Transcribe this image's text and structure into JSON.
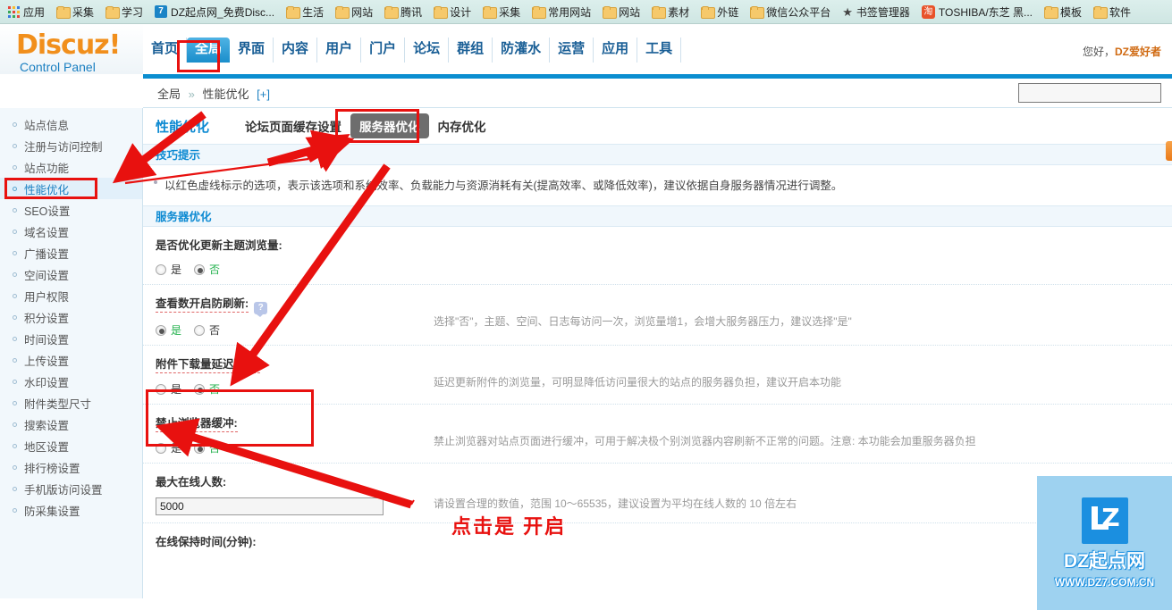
{
  "browser": {
    "bookmarks": [
      {
        "label": "应用",
        "icon": "apps-grid-icon"
      },
      {
        "label": "采集",
        "icon": "folder-icon"
      },
      {
        "label": "学习",
        "icon": "folder-icon"
      },
      {
        "label": "DZ起点网_免费Disc...",
        "icon": "dz-favicon-icon"
      },
      {
        "label": "生活",
        "icon": "folder-icon"
      },
      {
        "label": "网站",
        "icon": "folder-icon"
      },
      {
        "label": "腾讯",
        "icon": "folder-icon"
      },
      {
        "label": "设计",
        "icon": "folder-icon"
      },
      {
        "label": "采集",
        "icon": "folder-icon"
      },
      {
        "label": "常用网站",
        "icon": "folder-icon"
      },
      {
        "label": "网站",
        "icon": "folder-icon"
      },
      {
        "label": "素材",
        "icon": "folder-icon"
      },
      {
        "label": "外链",
        "icon": "folder-icon"
      },
      {
        "label": "微信公众平台",
        "icon": "folder-icon"
      },
      {
        "label": "书签管理器",
        "icon": "star-icon"
      },
      {
        "label": "TOSHIBA/东芝 黑...",
        "icon": "taobao-icon"
      },
      {
        "label": "模板",
        "icon": "folder-icon"
      },
      {
        "label": "软件",
        "icon": "folder-icon"
      }
    ]
  },
  "header": {
    "logo_main": "Discuz!",
    "logo_sub": "Control Panel",
    "greeting_prefix": "您好，",
    "greeting_user": "DZ爱好者",
    "nav": [
      {
        "label": "首页",
        "active": false
      },
      {
        "label": "全局",
        "active": true
      },
      {
        "label": "界面",
        "active": false
      },
      {
        "label": "内容",
        "active": false
      },
      {
        "label": "用户",
        "active": false
      },
      {
        "label": "门户",
        "active": false
      },
      {
        "label": "论坛",
        "active": false
      },
      {
        "label": "群组",
        "active": false
      },
      {
        "label": "防灌水",
        "active": false
      },
      {
        "label": "运营",
        "active": false
      },
      {
        "label": "应用",
        "active": false
      },
      {
        "label": "工具",
        "active": false
      }
    ]
  },
  "breadcrumb": {
    "root": "全局",
    "separator": "»",
    "current": "性能优化",
    "expand": "[+]"
  },
  "search": {
    "value": "",
    "placeholder": ""
  },
  "sidebar": {
    "items": [
      {
        "label": "站点信息",
        "active": false
      },
      {
        "label": "注册与访问控制",
        "active": false
      },
      {
        "label": "站点功能",
        "active": false
      },
      {
        "label": "性能优化",
        "active": true
      },
      {
        "label": "SEO设置",
        "active": false
      },
      {
        "label": "域名设置",
        "active": false
      },
      {
        "label": "广播设置",
        "active": false
      },
      {
        "label": "空间设置",
        "active": false
      },
      {
        "label": "用户权限",
        "active": false
      },
      {
        "label": "积分设置",
        "active": false
      },
      {
        "label": "时间设置",
        "active": false
      },
      {
        "label": "上传设置",
        "active": false
      },
      {
        "label": "水印设置",
        "active": false
      },
      {
        "label": "附件类型尺寸",
        "active": false
      },
      {
        "label": "搜索设置",
        "active": false
      },
      {
        "label": "地区设置",
        "active": false
      },
      {
        "label": "排行榜设置",
        "active": false
      },
      {
        "label": "手机版访问设置",
        "active": false
      },
      {
        "label": "防采集设置",
        "active": false
      }
    ]
  },
  "main": {
    "page_title": "性能优化",
    "tabs": [
      {
        "label": "论坛页面缓存设置",
        "active": false
      },
      {
        "label": "服务器优化",
        "active": true
      },
      {
        "label": "内存优化",
        "active": false
      }
    ],
    "tips_section_title": "技巧提示",
    "tips_text": "以红色虚线标示的选项，表示该选项和系统效率、负载能力与资源消耗有关(提高效率、或降低效率)，建议依据自身服务器情况进行调整。",
    "form_section_title": "服务器优化",
    "yes_label": "是",
    "no_label": "否",
    "rows": [
      {
        "label": "是否优化更新主题浏览量:",
        "selected": "否",
        "hint": "",
        "help_icon": false,
        "dashed": false
      },
      {
        "label": "查看数开启防刷新:",
        "selected": "是",
        "hint": "选择\"否\"，主题、空间、日志每访问一次，浏览量增1，会增大服务器压力，建议选择\"是\"",
        "help_icon": true,
        "dashed": true
      },
      {
        "label": "附件下载量延迟更新:",
        "selected": "否",
        "hint": "延迟更新附件的浏览量，可明显降低访问量很大的站点的服务器负担，建议开启本功能",
        "help_icon": false,
        "dashed": true
      },
      {
        "label": "禁止浏览器缓冲:",
        "selected": "否",
        "hint": "禁止浏览器对站点页面进行缓冲，可用于解决极个别浏览器内容刷新不正常的问题。注意: 本功能会加重服务器负担",
        "help_icon": false,
        "dashed": true
      }
    ],
    "max_online": {
      "label": "最大在线人数:",
      "value": "5000",
      "hint": "请设置合理的数值，范围 10～65535，建议设置为平均在线人数的 10 倍左右"
    },
    "online_keep": {
      "label": "在线保持时间(分钟):"
    }
  },
  "annotation": {
    "callout_text": "点击是  开启",
    "color": "#e8110f"
  },
  "watermark": {
    "logo_letters": "LZ",
    "line1": "DZ起点网",
    "line2": "WWW.DZ7.COM.CN"
  },
  "colors": {
    "accent_blue": "#0d8ad2",
    "nav_active": "#1a8ecb",
    "selected_green": "#22b14c",
    "annotation_red": "#e8110f",
    "logo_orange": "#f18f1c"
  }
}
